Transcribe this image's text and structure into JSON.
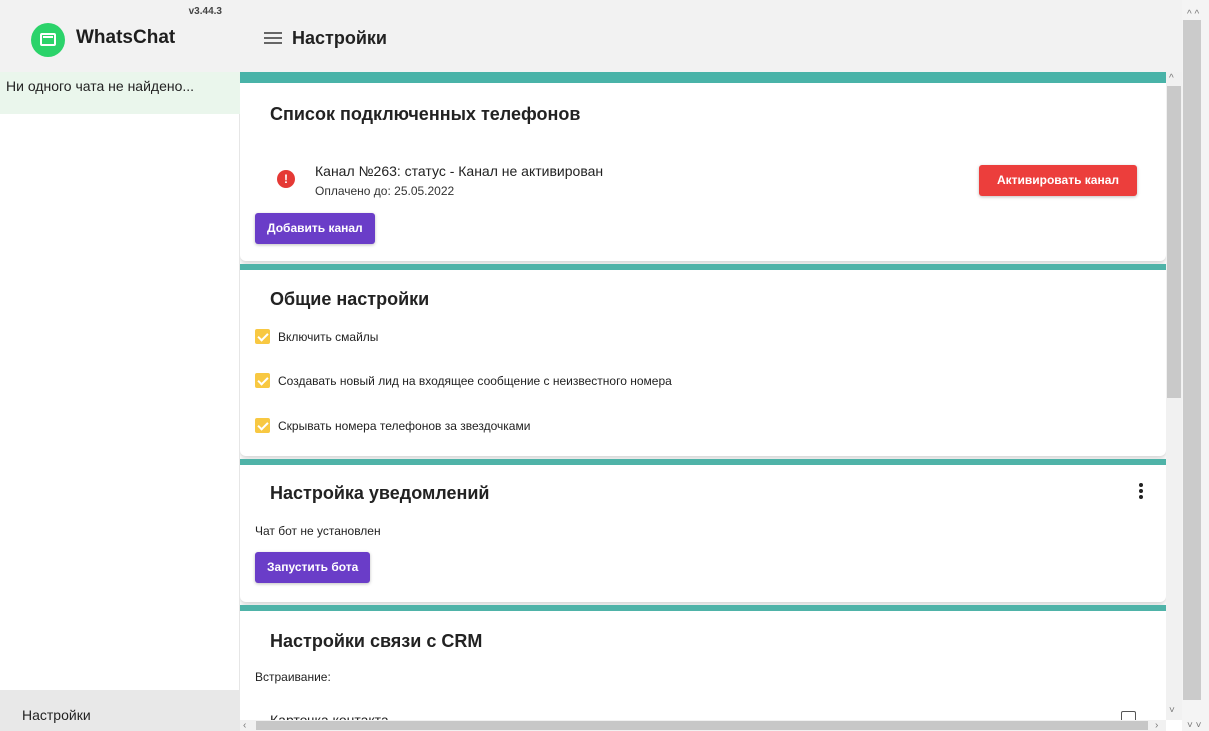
{
  "app": {
    "name": "WhatsChat",
    "version": "v3.44.3"
  },
  "sidebar": {
    "empty_text": "Ни одного чата не найдено...",
    "footer_label": "Настройки"
  },
  "header": {
    "title": "Настройки"
  },
  "phones": {
    "title": "Список подключенных телефонов",
    "channel_status": "Канал №263: статус - Канал не активирован",
    "paid_until": "Оплачено до: 25.05.2022",
    "activate_label": "Активировать канал",
    "add_label": "Добавить канал"
  },
  "general": {
    "title": "Общие настройки",
    "options": [
      {
        "label": "Включить смайлы",
        "checked": true
      },
      {
        "label": "Создавать новый лид на входящее сообщение с неизвестного номера",
        "checked": true
      },
      {
        "label": "Скрывать номера телефонов за звездочками",
        "checked": true
      }
    ]
  },
  "notifications": {
    "title": "Настройка уведомлений",
    "bot_status": "Чат бот не установлен",
    "start_bot_label": "Запустить бота"
  },
  "crm": {
    "title": "Настройки связи с CRM",
    "embed_label": "Встраивание:",
    "contact_card_label": "Карточка контакта",
    "contact_card_checked": false
  },
  "colors": {
    "accent_purple": "#6a3dc8",
    "danger_red": "#ec3e3c",
    "checkbox_yellow": "#f8c842",
    "brand_green": "#2bd36a"
  }
}
